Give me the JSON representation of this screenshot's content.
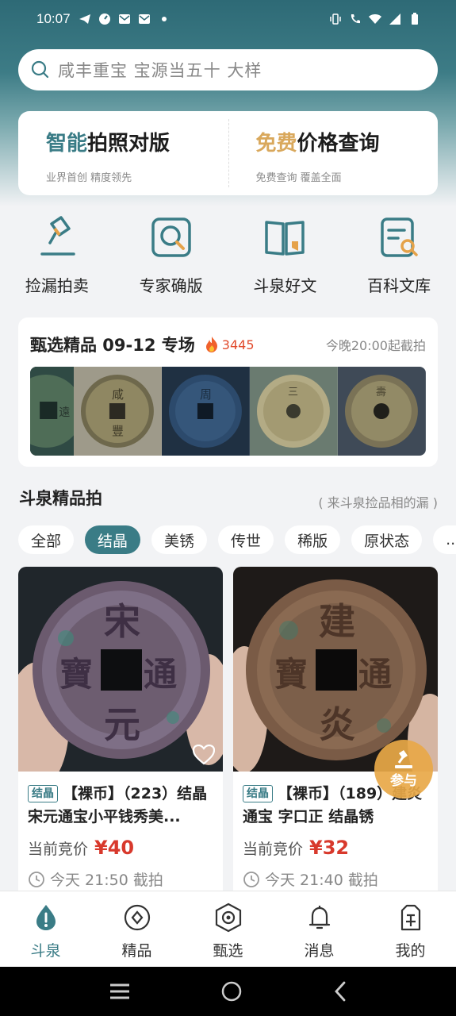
{
  "status_bar": {
    "time": "10:07",
    "left_icons": [
      "telegram-icon",
      "speed-icon",
      "mail-icon",
      "mail-icon",
      "dot-icon"
    ],
    "right_icons": [
      "vibrate-icon",
      "wifi-call-icon",
      "wifi-icon",
      "signal-icon",
      "battery-icon"
    ]
  },
  "search": {
    "placeholder": "咸丰重宝 宝源当五十 大样"
  },
  "features": [
    {
      "accent": "智能",
      "rest": "拍照对版",
      "sub": "业界首创 精度领先",
      "accent_color": "#3a7c86"
    },
    {
      "accent": "免费",
      "rest": "价格查询",
      "sub": "免费查询 覆盖全面",
      "accent_color": "#d9a85c"
    }
  ],
  "quick_links": [
    {
      "label": "捡漏拍卖",
      "icon": "auction-hammer-icon"
    },
    {
      "label": "专家确版",
      "icon": "magnify-coin-icon"
    },
    {
      "label": "斗泉好文",
      "icon": "book-icon"
    },
    {
      "label": "百科文库",
      "icon": "document-search-icon"
    }
  ],
  "selection": {
    "title": "甄选精品 09-12 专场",
    "hot_count": "3445",
    "end_time": "今晚20:00起截拍",
    "images": [
      "coin-image",
      "coin-image",
      "coin-image",
      "coin-image",
      "coin-image"
    ]
  },
  "section": {
    "title": "斗泉精品拍",
    "hint": "( 来斗泉捡品相的漏 )"
  },
  "chips": [
    {
      "label": "全部",
      "active": false
    },
    {
      "label": "结晶",
      "active": true
    },
    {
      "label": "美锈",
      "active": false
    },
    {
      "label": "传世",
      "active": false
    },
    {
      "label": "稀版",
      "active": false
    },
    {
      "label": "原状态",
      "active": false
    },
    {
      "label": "...",
      "active": false
    }
  ],
  "products": [
    {
      "tag": "结晶",
      "name": "【裸币】（223）结晶宋元通宝小平钱秀美...",
      "price_label": "当前竞价",
      "price": "¥40",
      "time": "今天 21:50 截拍"
    },
    {
      "tag": "结晶",
      "name": "【裸币】（189）建炎通宝 字口正 结晶锈",
      "price_label": "当前竞价",
      "price": "¥32",
      "time": "今天 21:40 截拍"
    }
  ],
  "fab": {
    "label": "参与"
  },
  "tabs": [
    {
      "label": "斗泉",
      "icon": "drop-icon",
      "active": true
    },
    {
      "label": "精品",
      "icon": "diamond-circle-icon",
      "active": false
    },
    {
      "label": "甄选",
      "icon": "hexagon-icon",
      "active": false
    },
    {
      "label": "消息",
      "icon": "bell-icon",
      "active": false
    },
    {
      "label": "我的",
      "icon": "profile-icon",
      "active": false
    }
  ],
  "colors": {
    "brand": "#3a7c86",
    "price": "#d8392c",
    "gold": "#d9a85c"
  }
}
